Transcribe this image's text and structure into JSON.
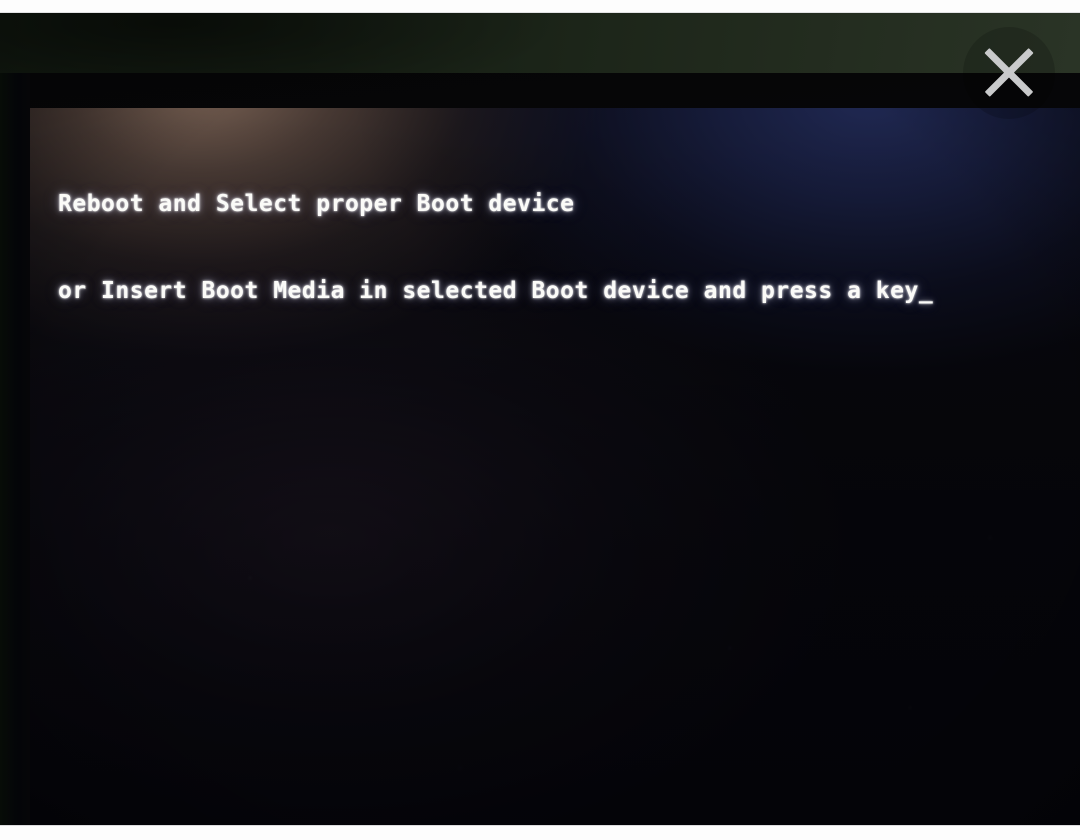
{
  "viewer": {
    "close_label": "Close",
    "close_icon": "close-icon",
    "top_band_label": "",
    "bottom_band_label": ""
  },
  "photo": {
    "subject": "computer-monitor-bios-error",
    "wall_color": "#1a2318",
    "bezel_color": "#070709",
    "screen_glow_warm": "#866c5c",
    "screen_glow_cool": "#212a56",
    "screen_base_color": "#07070c"
  },
  "bios": {
    "text_color": "#fbfbf8",
    "line1": "Reboot and Select proper Boot device",
    "line2": "or Insert Boot Media in selected Boot device and press a key",
    "cursor": "_"
  }
}
